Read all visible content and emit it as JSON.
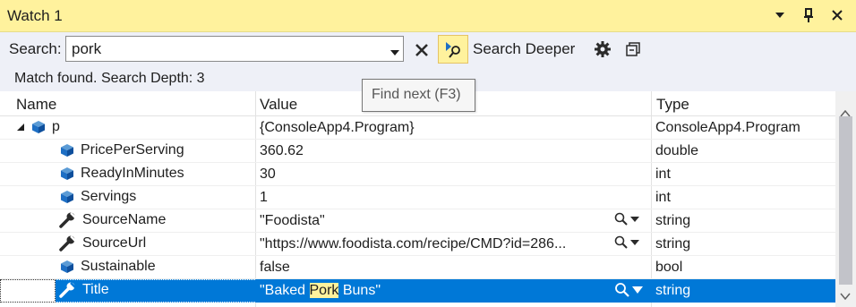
{
  "window": {
    "title": "Watch 1",
    "icons": [
      "dropdown-icon",
      "pin-icon",
      "close-icon"
    ]
  },
  "toolbar": {
    "search_label": "Search:",
    "search_value": "pork",
    "search_deeper_label": "Search Deeper"
  },
  "status": {
    "message": "Match found. Search Depth: 3"
  },
  "tooltip": {
    "text": "Find next (F3)"
  },
  "columns": {
    "name": "Name",
    "value": "Value",
    "type": "Type"
  },
  "rows": [
    {
      "name": "p",
      "value": "{ConsoleApp4.Program}",
      "type": "ConsoleApp4.Program",
      "icon": "object-icon"
    },
    {
      "name": "PricePerServing",
      "value": "360.62",
      "type": "double",
      "icon": "field-icon"
    },
    {
      "name": "ReadyInMinutes",
      "value": "30",
      "type": "int",
      "icon": "field-icon"
    },
    {
      "name": "Servings",
      "value": "1",
      "type": "int",
      "icon": "field-icon"
    },
    {
      "name": "SourceName",
      "value": "\"Foodista\"",
      "type": "string",
      "icon": "property-icon"
    },
    {
      "name": "SourceUrl",
      "value": "\"https://www.foodista.com/recipe/CMD?id=286...",
      "type": "string",
      "icon": "property-icon"
    },
    {
      "name": "Sustainable",
      "value": "false",
      "type": "bool",
      "icon": "field-icon"
    },
    {
      "name": "Title",
      "value_before": "\"Baked ",
      "value_match": "Pork",
      "value_after": " Buns\"",
      "type": "string",
      "icon": "property-icon"
    }
  ],
  "colors": {
    "title_bar": "#fff29d",
    "toolbar_bg": "#eef0f7",
    "selection": "#0078d7",
    "match_highlight": "#fff29d",
    "icon_blue": "#1e6fc4"
  }
}
